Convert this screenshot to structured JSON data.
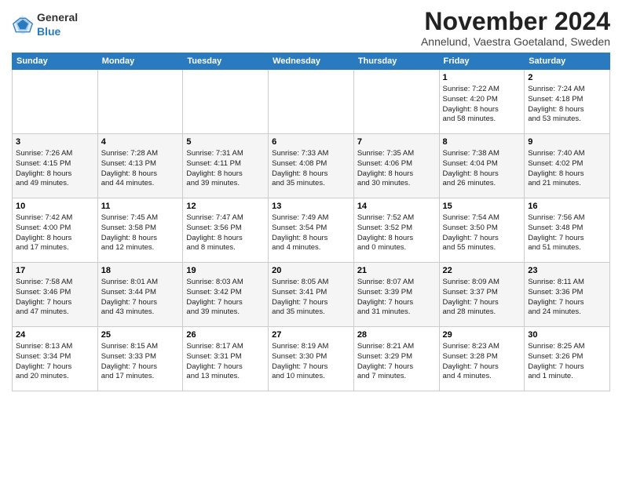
{
  "header": {
    "logo_general": "General",
    "logo_blue": "Blue",
    "month_title": "November 2024",
    "subtitle": "Annelund, Vaestra Goetaland, Sweden"
  },
  "weekdays": [
    "Sunday",
    "Monday",
    "Tuesday",
    "Wednesday",
    "Thursday",
    "Friday",
    "Saturday"
  ],
  "weeks": [
    [
      {
        "day": "",
        "info": ""
      },
      {
        "day": "",
        "info": ""
      },
      {
        "day": "",
        "info": ""
      },
      {
        "day": "",
        "info": ""
      },
      {
        "day": "",
        "info": ""
      },
      {
        "day": "1",
        "info": "Sunrise: 7:22 AM\nSunset: 4:20 PM\nDaylight: 8 hours\nand 58 minutes."
      },
      {
        "day": "2",
        "info": "Sunrise: 7:24 AM\nSunset: 4:18 PM\nDaylight: 8 hours\nand 53 minutes."
      }
    ],
    [
      {
        "day": "3",
        "info": "Sunrise: 7:26 AM\nSunset: 4:15 PM\nDaylight: 8 hours\nand 49 minutes."
      },
      {
        "day": "4",
        "info": "Sunrise: 7:28 AM\nSunset: 4:13 PM\nDaylight: 8 hours\nand 44 minutes."
      },
      {
        "day": "5",
        "info": "Sunrise: 7:31 AM\nSunset: 4:11 PM\nDaylight: 8 hours\nand 39 minutes."
      },
      {
        "day": "6",
        "info": "Sunrise: 7:33 AM\nSunset: 4:08 PM\nDaylight: 8 hours\nand 35 minutes."
      },
      {
        "day": "7",
        "info": "Sunrise: 7:35 AM\nSunset: 4:06 PM\nDaylight: 8 hours\nand 30 minutes."
      },
      {
        "day": "8",
        "info": "Sunrise: 7:38 AM\nSunset: 4:04 PM\nDaylight: 8 hours\nand 26 minutes."
      },
      {
        "day": "9",
        "info": "Sunrise: 7:40 AM\nSunset: 4:02 PM\nDaylight: 8 hours\nand 21 minutes."
      }
    ],
    [
      {
        "day": "10",
        "info": "Sunrise: 7:42 AM\nSunset: 4:00 PM\nDaylight: 8 hours\nand 17 minutes."
      },
      {
        "day": "11",
        "info": "Sunrise: 7:45 AM\nSunset: 3:58 PM\nDaylight: 8 hours\nand 12 minutes."
      },
      {
        "day": "12",
        "info": "Sunrise: 7:47 AM\nSunset: 3:56 PM\nDaylight: 8 hours\nand 8 minutes."
      },
      {
        "day": "13",
        "info": "Sunrise: 7:49 AM\nSunset: 3:54 PM\nDaylight: 8 hours\nand 4 minutes."
      },
      {
        "day": "14",
        "info": "Sunrise: 7:52 AM\nSunset: 3:52 PM\nDaylight: 8 hours\nand 0 minutes."
      },
      {
        "day": "15",
        "info": "Sunrise: 7:54 AM\nSunset: 3:50 PM\nDaylight: 7 hours\nand 55 minutes."
      },
      {
        "day": "16",
        "info": "Sunrise: 7:56 AM\nSunset: 3:48 PM\nDaylight: 7 hours\nand 51 minutes."
      }
    ],
    [
      {
        "day": "17",
        "info": "Sunrise: 7:58 AM\nSunset: 3:46 PM\nDaylight: 7 hours\nand 47 minutes."
      },
      {
        "day": "18",
        "info": "Sunrise: 8:01 AM\nSunset: 3:44 PM\nDaylight: 7 hours\nand 43 minutes."
      },
      {
        "day": "19",
        "info": "Sunrise: 8:03 AM\nSunset: 3:42 PM\nDaylight: 7 hours\nand 39 minutes."
      },
      {
        "day": "20",
        "info": "Sunrise: 8:05 AM\nSunset: 3:41 PM\nDaylight: 7 hours\nand 35 minutes."
      },
      {
        "day": "21",
        "info": "Sunrise: 8:07 AM\nSunset: 3:39 PM\nDaylight: 7 hours\nand 31 minutes."
      },
      {
        "day": "22",
        "info": "Sunrise: 8:09 AM\nSunset: 3:37 PM\nDaylight: 7 hours\nand 28 minutes."
      },
      {
        "day": "23",
        "info": "Sunrise: 8:11 AM\nSunset: 3:36 PM\nDaylight: 7 hours\nand 24 minutes."
      }
    ],
    [
      {
        "day": "24",
        "info": "Sunrise: 8:13 AM\nSunset: 3:34 PM\nDaylight: 7 hours\nand 20 minutes."
      },
      {
        "day": "25",
        "info": "Sunrise: 8:15 AM\nSunset: 3:33 PM\nDaylight: 7 hours\nand 17 minutes."
      },
      {
        "day": "26",
        "info": "Sunrise: 8:17 AM\nSunset: 3:31 PM\nDaylight: 7 hours\nand 13 minutes."
      },
      {
        "day": "27",
        "info": "Sunrise: 8:19 AM\nSunset: 3:30 PM\nDaylight: 7 hours\nand 10 minutes."
      },
      {
        "day": "28",
        "info": "Sunrise: 8:21 AM\nSunset: 3:29 PM\nDaylight: 7 hours\nand 7 minutes."
      },
      {
        "day": "29",
        "info": "Sunrise: 8:23 AM\nSunset: 3:28 PM\nDaylight: 7 hours\nand 4 minutes."
      },
      {
        "day": "30",
        "info": "Sunrise: 8:25 AM\nSunset: 3:26 PM\nDaylight: 7 hours\nand 1 minute."
      }
    ]
  ]
}
